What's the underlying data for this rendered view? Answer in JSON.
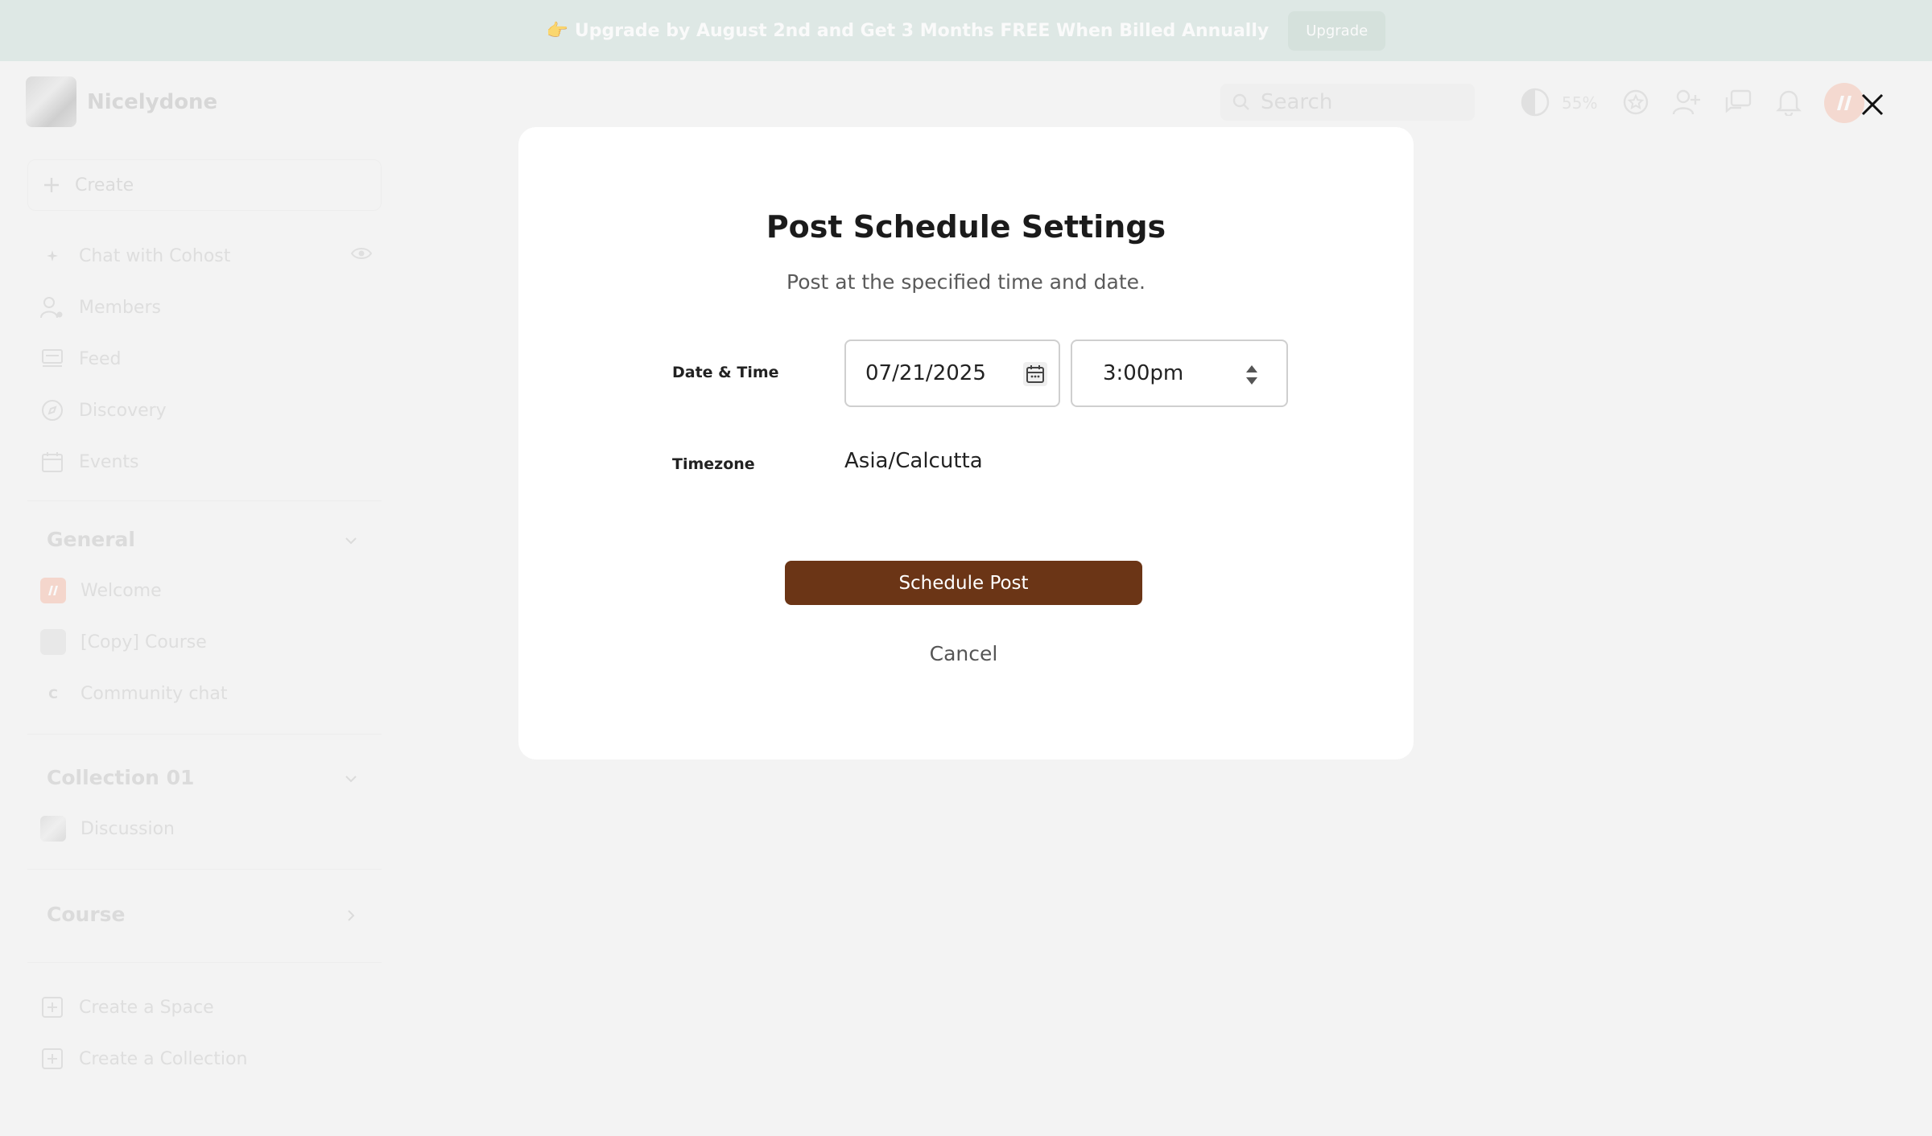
{
  "banner": {
    "text": "👉 Upgrade by August 2nd and Get 3 Months FREE When Billed Annually",
    "button_label": "Upgrade"
  },
  "header": {
    "community_name": "Nicelydone",
    "search_placeholder": "Search",
    "theme_percent": "55%"
  },
  "sidebar": {
    "create_label": "Create",
    "nav": [
      {
        "label": "Chat with Cohost",
        "icon": "sparkle-icon"
      },
      {
        "label": "Members",
        "icon": "members-icon"
      },
      {
        "label": "Feed",
        "icon": "feed-icon"
      },
      {
        "label": "Discovery",
        "icon": "compass-icon"
      },
      {
        "label": "Events",
        "icon": "calendar-icon"
      }
    ],
    "sections": [
      {
        "title": "General",
        "items": [
          "Welcome",
          "[Copy] Course",
          "Community chat"
        ]
      },
      {
        "title": "Collection 01",
        "items": [
          "Discussion"
        ]
      },
      {
        "title": "Course",
        "items": []
      }
    ],
    "community_chat_initial": "C",
    "actions": [
      "Create a Space",
      "Create a Collection"
    ]
  },
  "modal": {
    "title": "Post Schedule Settings",
    "subtitle": "Post at the specified time and date.",
    "date_time_label": "Date & Time",
    "date_value": "07/21/2025",
    "time_value": "3:00pm",
    "timezone_label": "Timezone",
    "timezone_value": "Asia/Calcutta",
    "submit_label": "Schedule Post",
    "cancel_label": "Cancel"
  },
  "colors": {
    "primary": "#6b3516",
    "banner_bg": "#d5e4df",
    "page_bg": "#f5f5f4"
  }
}
